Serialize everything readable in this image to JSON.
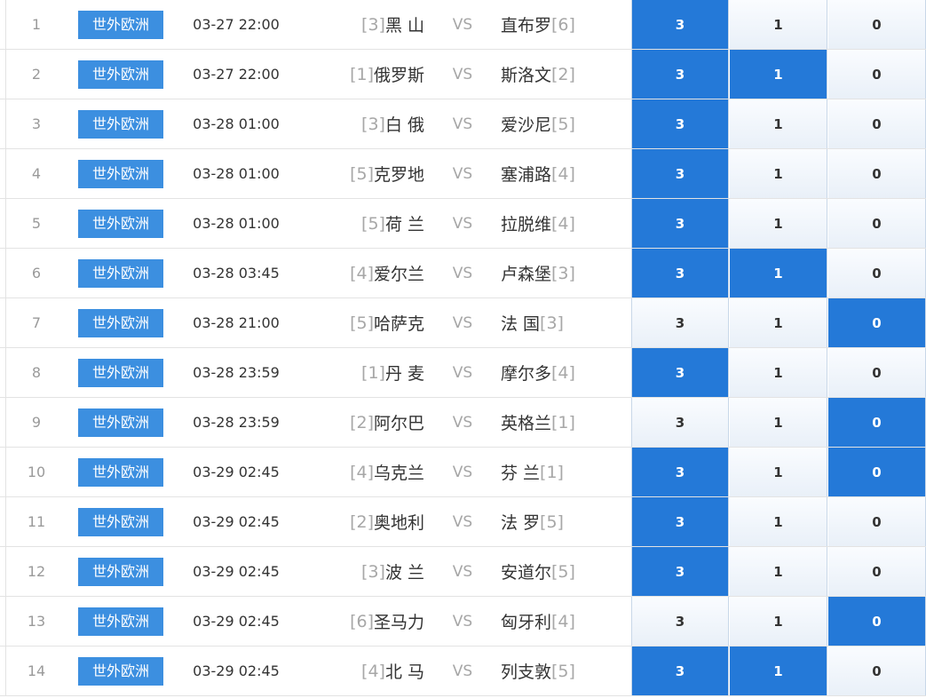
{
  "matches": [
    {
      "no": "1",
      "league": "世外欧洲",
      "time": "03-27 22:00",
      "home_rank": "[3]",
      "home": "黑 山",
      "vs": "VS",
      "away": "直布罗",
      "away_rank": "[6]",
      "odds": [
        {
          "v": "3",
          "hl": true
        },
        {
          "v": "1",
          "hl": false
        },
        {
          "v": "0",
          "hl": false
        }
      ]
    },
    {
      "no": "2",
      "league": "世外欧洲",
      "time": "03-27 22:00",
      "home_rank": "[1]",
      "home": "俄罗斯",
      "vs": "VS",
      "away": "斯洛文",
      "away_rank": "[2]",
      "odds": [
        {
          "v": "3",
          "hl": true
        },
        {
          "v": "1",
          "hl": true
        },
        {
          "v": "0",
          "hl": false
        }
      ]
    },
    {
      "no": "3",
      "league": "世外欧洲",
      "time": "03-28 01:00",
      "home_rank": "[3]",
      "home": "白 俄",
      "vs": "VS",
      "away": "爱沙尼",
      "away_rank": "[5]",
      "odds": [
        {
          "v": "3",
          "hl": true
        },
        {
          "v": "1",
          "hl": false
        },
        {
          "v": "0",
          "hl": false
        }
      ]
    },
    {
      "no": "4",
      "league": "世外欧洲",
      "time": "03-28 01:00",
      "home_rank": "[5]",
      "home": "克罗地",
      "vs": "VS",
      "away": "塞浦路",
      "away_rank": "[4]",
      "odds": [
        {
          "v": "3",
          "hl": true
        },
        {
          "v": "1",
          "hl": false
        },
        {
          "v": "0",
          "hl": false
        }
      ]
    },
    {
      "no": "5",
      "league": "世外欧洲",
      "time": "03-28 01:00",
      "home_rank": "[5]",
      "home": "荷 兰",
      "vs": "VS",
      "away": "拉脱维",
      "away_rank": "[4]",
      "odds": [
        {
          "v": "3",
          "hl": true
        },
        {
          "v": "1",
          "hl": false
        },
        {
          "v": "0",
          "hl": false
        }
      ]
    },
    {
      "no": "6",
      "league": "世外欧洲",
      "time": "03-28 03:45",
      "home_rank": "[4]",
      "home": "爱尔兰",
      "vs": "VS",
      "away": "卢森堡",
      "away_rank": "[3]",
      "odds": [
        {
          "v": "3",
          "hl": true
        },
        {
          "v": "1",
          "hl": true
        },
        {
          "v": "0",
          "hl": false
        }
      ]
    },
    {
      "no": "7",
      "league": "世外欧洲",
      "time": "03-28 21:00",
      "home_rank": "[5]",
      "home": "哈萨克",
      "vs": "VS",
      "away": "法 国",
      "away_rank": "[3]",
      "odds": [
        {
          "v": "3",
          "hl": false
        },
        {
          "v": "1",
          "hl": false
        },
        {
          "v": "0",
          "hl": true
        }
      ]
    },
    {
      "no": "8",
      "league": "世外欧洲",
      "time": "03-28 23:59",
      "home_rank": "[1]",
      "home": "丹 麦",
      "vs": "VS",
      "away": "摩尔多",
      "away_rank": "[4]",
      "odds": [
        {
          "v": "3",
          "hl": true
        },
        {
          "v": "1",
          "hl": false
        },
        {
          "v": "0",
          "hl": false
        }
      ]
    },
    {
      "no": "9",
      "league": "世外欧洲",
      "time": "03-28 23:59",
      "home_rank": "[2]",
      "home": "阿尔巴",
      "vs": "VS",
      "away": "英格兰",
      "away_rank": "[1]",
      "odds": [
        {
          "v": "3",
          "hl": false
        },
        {
          "v": "1",
          "hl": false
        },
        {
          "v": "0",
          "hl": true
        }
      ]
    },
    {
      "no": "10",
      "league": "世外欧洲",
      "time": "03-29 02:45",
      "home_rank": "[4]",
      "home": "乌克兰",
      "vs": "VS",
      "away": "芬 兰",
      "away_rank": "[1]",
      "odds": [
        {
          "v": "3",
          "hl": true
        },
        {
          "v": "1",
          "hl": false
        },
        {
          "v": "0",
          "hl": true
        }
      ]
    },
    {
      "no": "11",
      "league": "世外欧洲",
      "time": "03-29 02:45",
      "home_rank": "[2]",
      "home": "奥地利",
      "vs": "VS",
      "away": "法 罗",
      "away_rank": "[5]",
      "odds": [
        {
          "v": "3",
          "hl": true
        },
        {
          "v": "1",
          "hl": false
        },
        {
          "v": "0",
          "hl": false
        }
      ]
    },
    {
      "no": "12",
      "league": "世外欧洲",
      "time": "03-29 02:45",
      "home_rank": "[3]",
      "home": "波 兰",
      "vs": "VS",
      "away": "安道尔",
      "away_rank": "[5]",
      "odds": [
        {
          "v": "3",
          "hl": true
        },
        {
          "v": "1",
          "hl": false
        },
        {
          "v": "0",
          "hl": false
        }
      ]
    },
    {
      "no": "13",
      "league": "世外欧洲",
      "time": "03-29 02:45",
      "home_rank": "[6]",
      "home": "圣马力",
      "vs": "VS",
      "away": "匈牙利",
      "away_rank": "[4]",
      "odds": [
        {
          "v": "3",
          "hl": false
        },
        {
          "v": "1",
          "hl": false
        },
        {
          "v": "0",
          "hl": true
        }
      ]
    },
    {
      "no": "14",
      "league": "世外欧洲",
      "time": "03-29 02:45",
      "home_rank": "[4]",
      "home": "北 马",
      "vs": "VS",
      "away": "列支敦",
      "away_rank": "[5]",
      "odds": [
        {
          "v": "3",
          "hl": true
        },
        {
          "v": "1",
          "hl": true
        },
        {
          "v": "0",
          "hl": false
        }
      ]
    }
  ]
}
